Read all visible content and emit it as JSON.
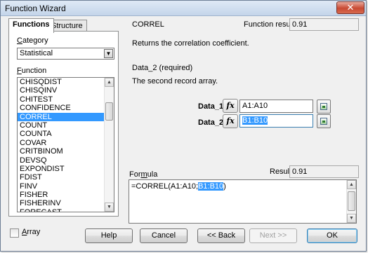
{
  "window": {
    "title": "Function Wizard",
    "close_glyph": "✕"
  },
  "tabs": [
    {
      "label": "Functions",
      "active": true
    },
    {
      "label": "Structure",
      "active": false
    }
  ],
  "category": {
    "label": "Category",
    "value": "Statistical"
  },
  "function_list": {
    "label": "Function",
    "items": [
      "CHISQDIST",
      "CHISQINV",
      "CHITEST",
      "CONFIDENCE",
      "CORREL",
      "COUNT",
      "COUNTA",
      "COVAR",
      "CRITBINOM",
      "DEVSQ",
      "EXPONDIST",
      "FDIST",
      "FINV",
      "FISHER",
      "FISHERINV",
      "FORECAST"
    ],
    "selected": "CORREL"
  },
  "function_info": {
    "name": "CORREL",
    "result_label": "Function result",
    "result_value": "0.91",
    "description": "Returns the correlation coefficient.",
    "arg_heading": "Data_2 (required)",
    "arg_description": "The second record array."
  },
  "arguments": [
    {
      "label": "Data_1",
      "value": "A1:A10",
      "selected": false
    },
    {
      "label": "Data_2",
      "value": "B1:B10",
      "selected": true
    }
  ],
  "fx_glyph": "fx",
  "formula": {
    "label": "Formula",
    "result_label": "Result",
    "result_value": "0.91",
    "text_before": "=CORREL(A1:A10;",
    "text_selected": "B1:B10",
    "text_after": ")"
  },
  "array_checkbox": {
    "label": "Array",
    "checked": false
  },
  "buttons": {
    "help": "Help",
    "cancel": "Cancel",
    "back": "<< Back",
    "next": "Next >>",
    "ok": "OK"
  },
  "icons": {
    "close": "close-icon",
    "dropdown": "chevron-down-icon",
    "fx": "function-fx-icon",
    "shrink": "shrink-dialog-icon"
  }
}
